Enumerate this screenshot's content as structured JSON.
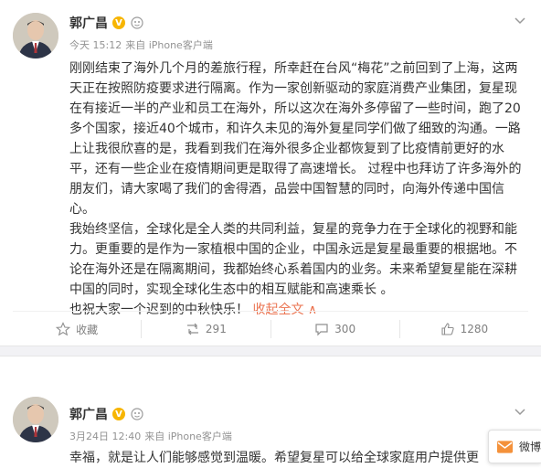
{
  "posts": [
    {
      "author": "郭广昌",
      "verified_mark": "V",
      "time": "今天 15:12",
      "source": "来自 iPhone客户端",
      "paragraphs": [
        "刚刚结束了海外几个月的差旅行程，所幸赶在台风“梅花”之前回到了上海，这两天正在按照防疫要求进行隔离。作为一家创新驱动的家庭消费产业集团，复星现在有接近一半的产业和员工在海外，所以这次在海外多停留了一些时间，跑了20多个国家，接近40个城市，和许久未见的海外复星同学们做了细致的沟通。一路上让我很欣喜的是，我看到我们在海外很多企业都恢复到了比疫情前更好的水平，还有一些企业在疫情期间更是取得了高速增长。 过程中也拜访了许多海外的朋友们，请大家喝了我们的舍得酒，品尝中国智慧的同时，向海外传递中国信心。",
        "我始终坚信，全球化是全人类的共同利益，复星的竞争力在于全球化的视野和能力。更重要的是作为一家植根中国的企业，中国永远是复星最重要的根据地。不论在海外还是在隔离期间，我都始终心系着国内的业务。未来希望复星能在深耕中国的同时，实现全球化生态中的相互赋能和高速乘长 。",
        "也祝大家一个迟到的中秋快乐！"
      ],
      "collapse_label": "收起全文 ∧",
      "actions": {
        "favorite": "收藏",
        "repost": "291",
        "comment": "300",
        "like": "1280"
      }
    },
    {
      "author": "郭广昌",
      "verified_mark": "V",
      "time": "3月24日 12:40",
      "source": "来自 iPhone客户端",
      "text": "幸福，就是让人们能够感觉到温暖。希望复星可以给全球家庭用户提供更"
    }
  ],
  "floating_widget": {
    "label": "微博"
  },
  "colors": {
    "link": "#eb7350",
    "badge": "#f7b500",
    "meta": "#939393"
  }
}
